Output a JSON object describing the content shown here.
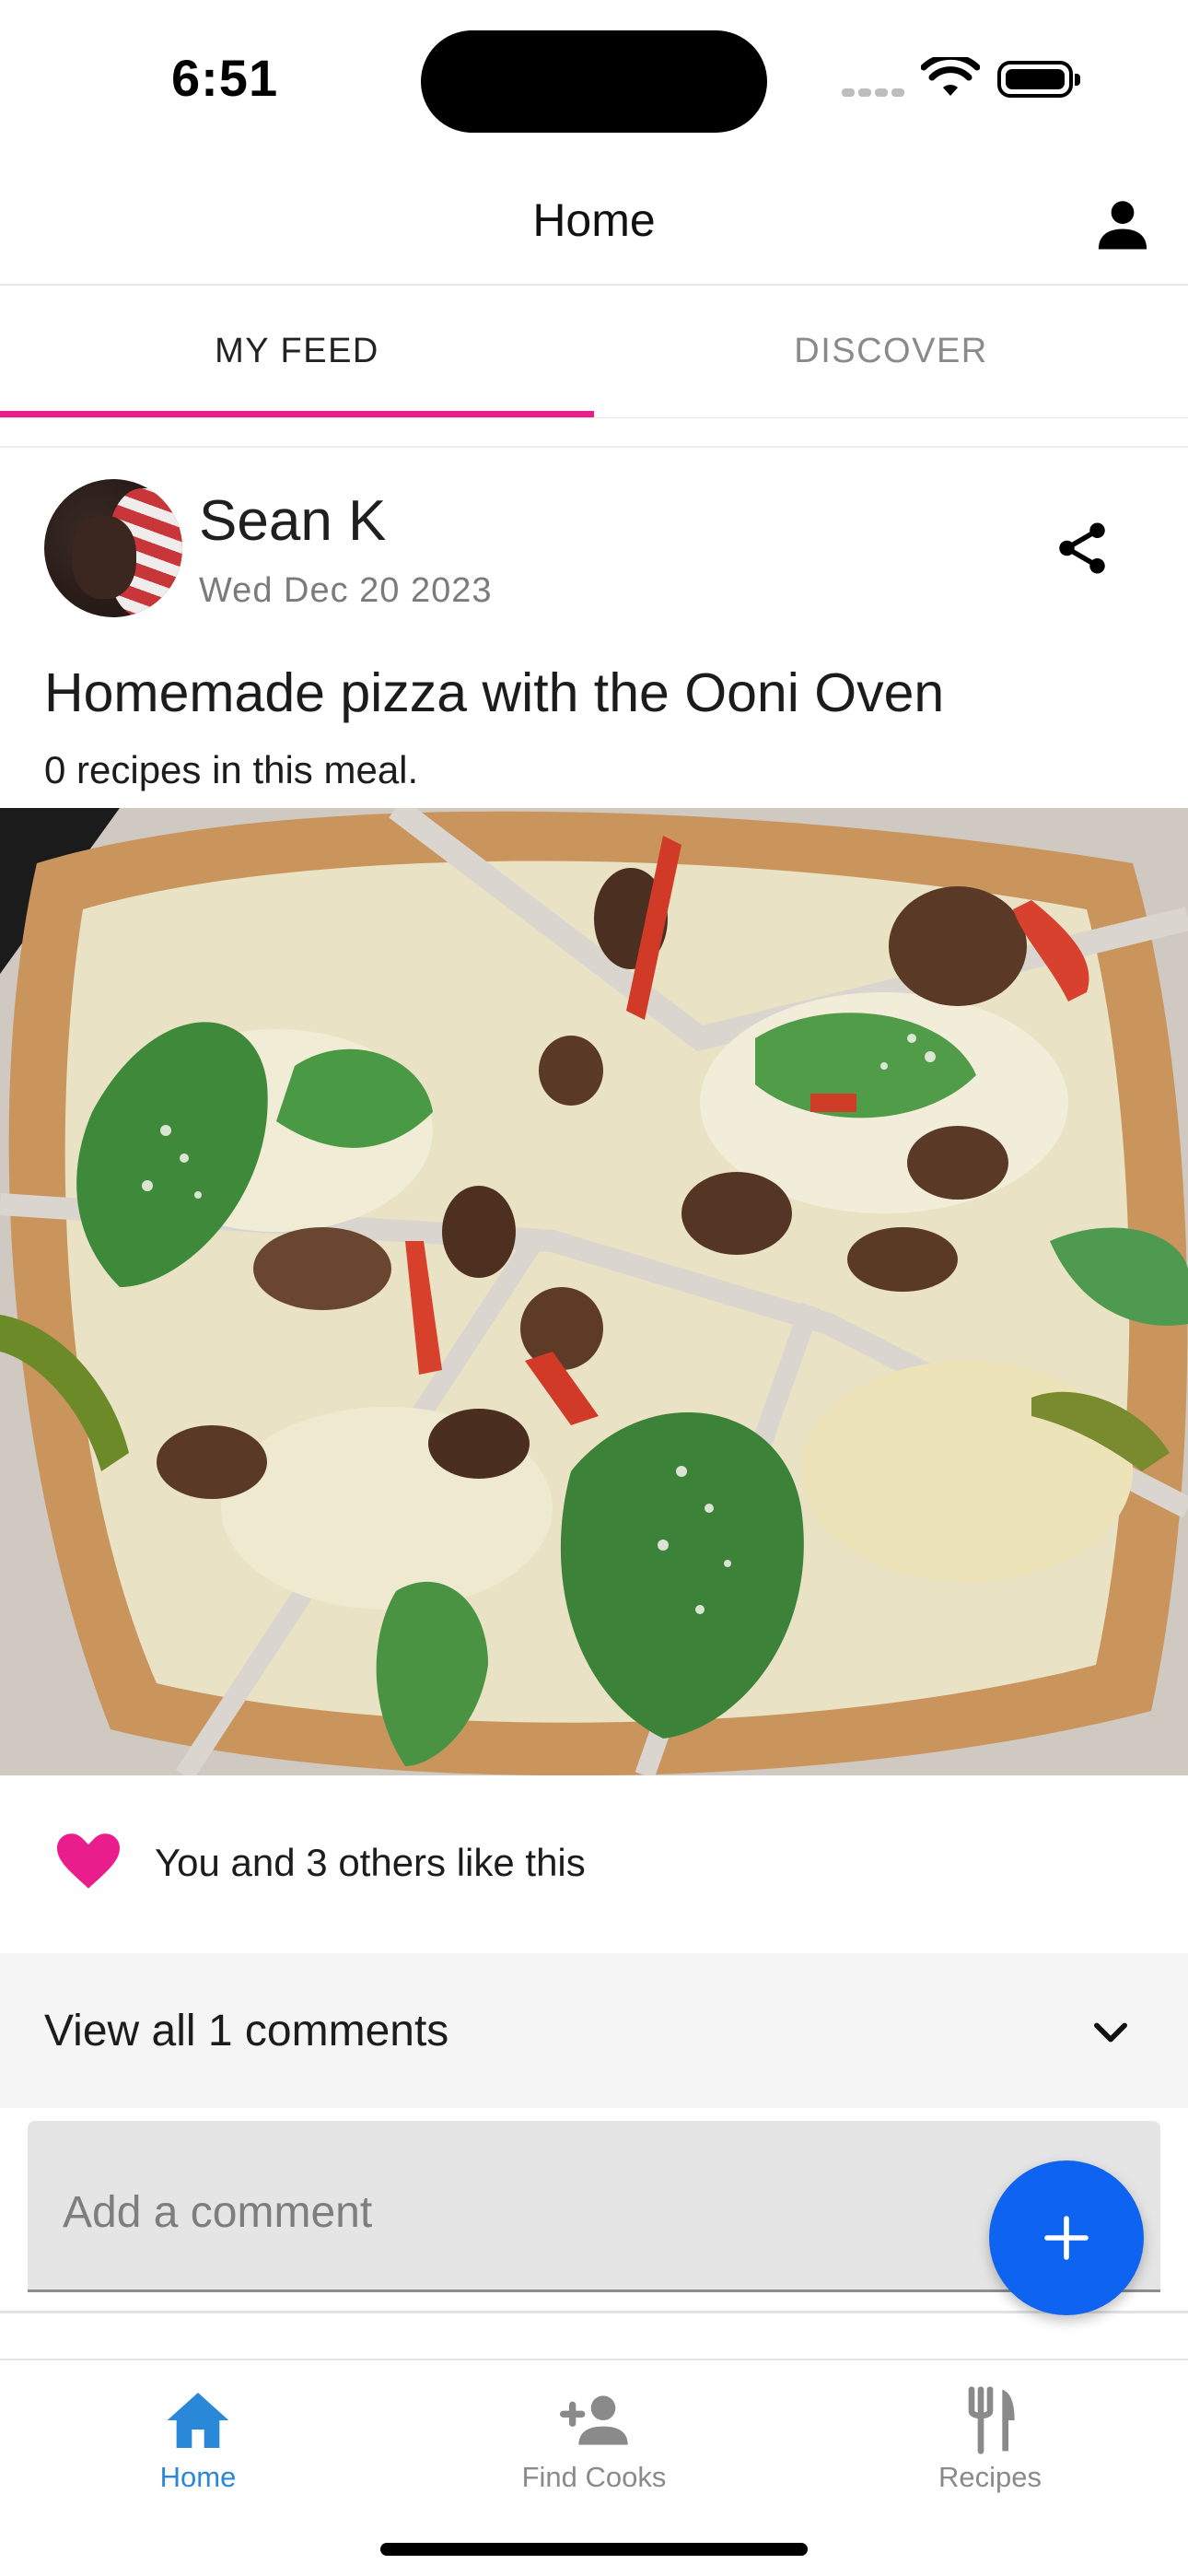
{
  "status_bar": {
    "time": "6:51"
  },
  "header": {
    "title": "Home"
  },
  "tabs": [
    {
      "label": "MY FEED",
      "active": true
    },
    {
      "label": "DISCOVER",
      "active": false
    }
  ],
  "post": {
    "author": "Sean K",
    "date": "Wed Dec 20 2023",
    "title": "Homemade pizza with the Ooni Oven",
    "recipe_count_text": "0 recipes in this meal.",
    "likes_text": "You and 3 others like this",
    "comments_label": "View all 1 comments",
    "comment_placeholder": "Add a comment"
  },
  "bottom_nav": [
    {
      "label": "Home",
      "icon": "home-icon",
      "active": true
    },
    {
      "label": "Find Cooks",
      "icon": "add-person-icon",
      "active": false
    },
    {
      "label": "Recipes",
      "icon": "fork-knife-icon",
      "active": false
    }
  ],
  "colors": {
    "tab_accent": "#e91e8c",
    "heart": "#e91e8c",
    "fab": "#0e64f0",
    "nav_active": "#2a88d8",
    "nav_inactive": "#8a8a8a"
  }
}
